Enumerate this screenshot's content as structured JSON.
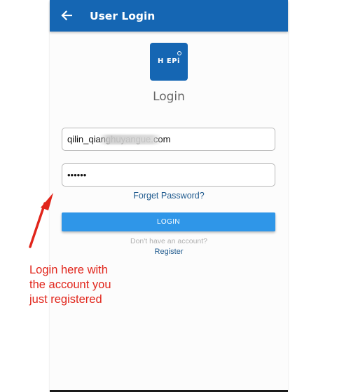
{
  "appbar": {
    "title": "User Login",
    "back_icon": "arrow-left-icon",
    "color": "#1566b3"
  },
  "logo": {
    "text": "H EPi",
    "color": "#1566b3"
  },
  "page": {
    "heading": "Login"
  },
  "form": {
    "email_value": "qilin_qianghuyangue.com",
    "password_value": "••••••",
    "forgot_label": "Forget Password?",
    "login_label": "LOGIN",
    "login_color": "#2f96e8",
    "no_account_text": "Don't have an account?",
    "register_label": "Register"
  },
  "annotation": {
    "lines": [
      "Login here with",
      "the account you",
      "just registered"
    ],
    "color": "#e1251b"
  }
}
